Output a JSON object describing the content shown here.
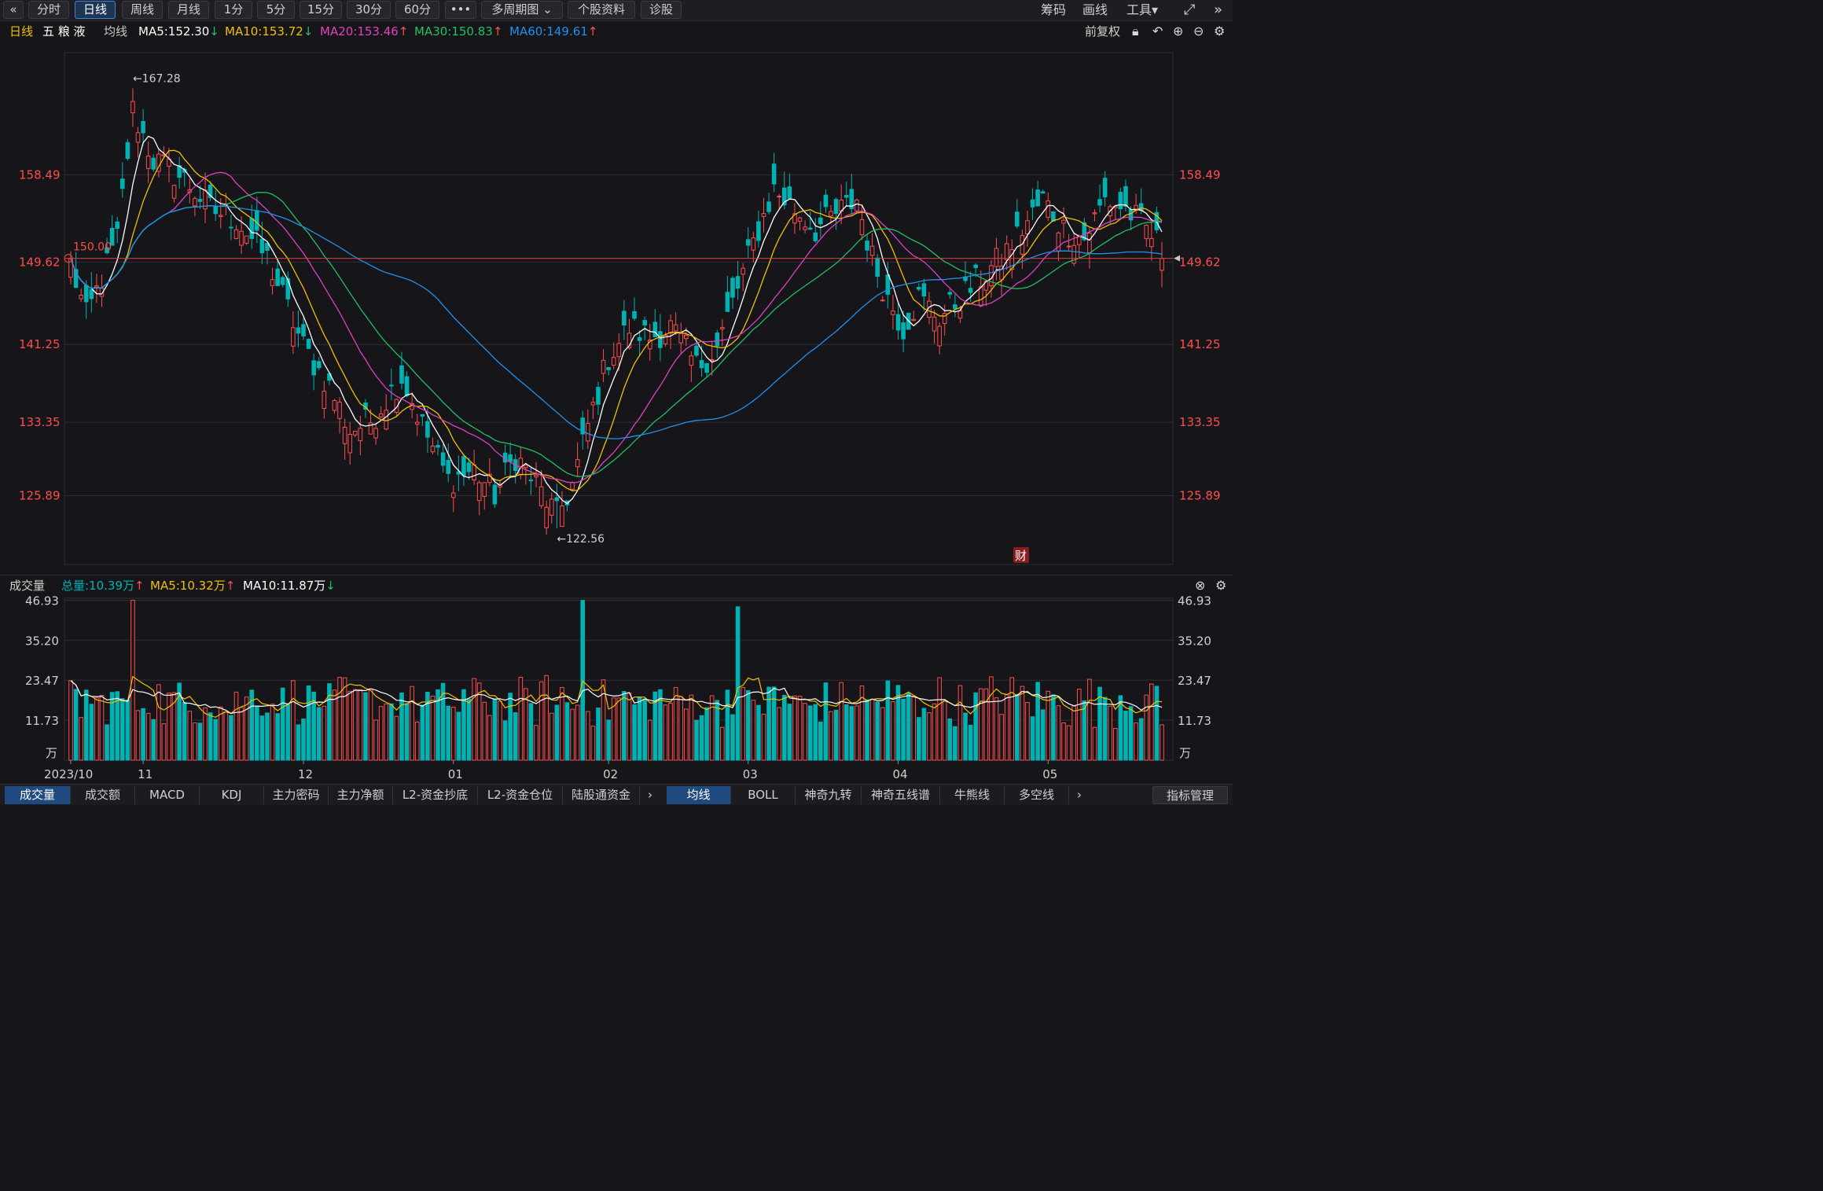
{
  "topbar": {
    "back_icon": "«",
    "periods": [
      "分时",
      "日线",
      "周线",
      "月线",
      "1分",
      "5分",
      "15分",
      "30分",
      "60分",
      "•••",
      "多周期图 ⌄",
      "个股资料",
      "诊股"
    ],
    "active_index": 1,
    "right": [
      "筹码",
      "画线",
      "工具▾"
    ]
  },
  "info": {
    "period": "日线",
    "stock": "五 粮 液",
    "ma_label": "均线",
    "ma5": "MA5:152.30",
    "ma5_arrow": "↓",
    "ma10": "MA10:153.72",
    "ma10_arrow": "↓",
    "ma20": "MA20:153.46",
    "ma20_arrow": "↑",
    "ma30": "MA30:150.83",
    "ma30_arrow": "↑",
    "ma60": "MA60:149.61",
    "ma60_arrow": "↑",
    "adjust": "前复权"
  },
  "colors": {
    "up": "#ff4d4d",
    "down": "#00b2b2",
    "ma5": "#ffffff",
    "ma10": "#f0c000",
    "ma20": "#e040c0",
    "ma30": "#20c060",
    "ma60": "#2090f0",
    "price_line": "#e04040"
  },
  "volume_info": {
    "title": "成交量",
    "total": "总量:10.39万",
    "total_arrow": "↑",
    "ma5": "MA5:10.32万",
    "ma5_arrow": "↑",
    "ma10": "MA10:11.87万",
    "ma10_arrow": "↓"
  },
  "bottom_tabs_left": [
    "成交量",
    "成交额",
    "MACD",
    "KDJ",
    "主力密码",
    "主力净额",
    "L2-资金抄底",
    "L2-资金仓位",
    "陆股通资金"
  ],
  "bottom_tabs_right": [
    "均线",
    "BOLL",
    "神奇九转",
    "神奇五线谱",
    "牛熊线",
    "多空线"
  ],
  "bottom_right_button": "指标管理",
  "chart_data": [
    {
      "type": "candlestick",
      "title": "日线 五粮液",
      "price_ticks": [
        158.49,
        149.62,
        141.25,
        133.35,
        125.89
      ],
      "ylim": [
        118.9,
        170.9
      ],
      "x_labels": [
        "2023/10",
        "11",
        "12",
        "01",
        "02",
        "03",
        "04",
        "05"
      ],
      "annotations": {
        "high": "←167.28",
        "low": "←122.56",
        "price_marker": "150.00",
        "finance_badge": "财"
      },
      "current_price": 150.0,
      "summary": {
        "high": 167.28,
        "low": 122.56,
        "ma5": 152.3,
        "ma10": 153.72,
        "ma20": 153.46,
        "ma30": 150.83,
        "ma60": 149.61
      },
      "waypoints": [
        [
          0,
          149.5
        ],
        [
          3,
          144.0
        ],
        [
          6,
          148.0
        ],
        [
          9,
          152.0
        ],
        [
          12,
          165.0
        ],
        [
          16,
          160.0
        ],
        [
          22,
          158.0
        ],
        [
          27,
          155.0
        ],
        [
          32,
          154.0
        ],
        [
          38,
          150.0
        ],
        [
          45,
          141.0
        ],
        [
          50,
          137.0
        ],
        [
          54,
          132.5
        ],
        [
          58,
          133.5
        ],
        [
          64,
          138.0
        ],
        [
          68,
          133.0
        ],
        [
          73,
          127.5
        ],
        [
          78,
          128.5
        ],
        [
          82,
          126.0
        ],
        [
          86,
          130.0
        ],
        [
          90,
          127.0
        ],
        [
          94,
          123.8
        ],
        [
          97,
          127.0
        ],
        [
          100,
          133.0
        ],
        [
          104,
          140.0
        ],
        [
          108,
          143.0
        ],
        [
          112,
          142.0
        ],
        [
          116,
          143.0
        ],
        [
          121,
          139.0
        ],
        [
          125,
          141.0
        ],
        [
          129,
          147.0
        ],
        [
          133,
          153.0
        ],
        [
          136,
          157.0
        ],
        [
          140,
          155.0
        ],
        [
          144,
          153.0
        ],
        [
          148,
          154.5
        ],
        [
          152,
          156.0
        ],
        [
          155,
          150.0
        ],
        [
          158,
          146.0
        ],
        [
          161,
          143.0
        ],
        [
          164,
          146.0
        ],
        [
          168,
          144.0
        ],
        [
          172,
          146.0
        ],
        [
          176,
          148.0
        ],
        [
          180,
          150.0
        ],
        [
          184,
          153.0
        ],
        [
          188,
          156.0
        ],
        [
          192,
          153.0
        ],
        [
          196,
          152.0
        ],
        [
          200,
          156.0
        ],
        [
          204,
          155.0
        ],
        [
          208,
          153.0
        ],
        [
          211,
          151.0
        ]
      ]
    },
    {
      "type": "bar",
      "title": "成交量",
      "unit": "万",
      "y_ticks": [
        46.93,
        35.2,
        23.47,
        11.73
      ],
      "ylim": [
        0,
        47.5
      ],
      "last_total": 10.39,
      "ma5_last": 10.32,
      "ma10_last": 11.87
    }
  ]
}
